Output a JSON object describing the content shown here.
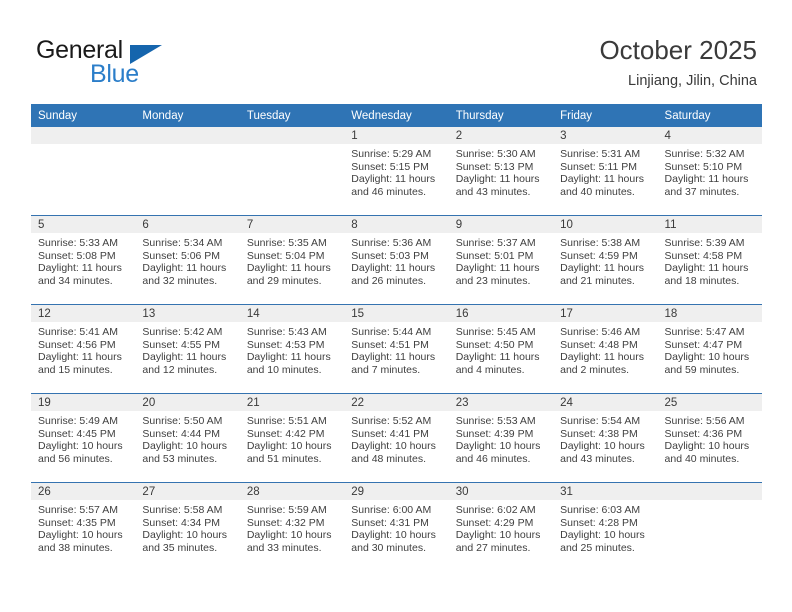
{
  "brand": {
    "word_one": "General",
    "word_two": "Blue",
    "triangle_color": "#1565ad",
    "blue_color": "#2b7ec9"
  },
  "header": {
    "month_title": "October 2025",
    "location": "Linjiang, Jilin, China",
    "header_bg": "#2f74b5",
    "band_bg": "#efefef"
  },
  "weekday_headers": [
    "Sunday",
    "Monday",
    "Tuesday",
    "Wednesday",
    "Thursday",
    "Friday",
    "Saturday"
  ],
  "labels": {
    "sunrise_prefix": "Sunrise:",
    "sunset_prefix": "Sunset:",
    "daylight_prefix": "Daylight:"
  },
  "weeks": [
    [
      {
        "day": "",
        "empty": true
      },
      {
        "day": "",
        "empty": true
      },
      {
        "day": "",
        "empty": true
      },
      {
        "day": "1",
        "sunrise": "Sunrise: 5:29 AM",
        "sunset": "Sunset: 5:15 PM",
        "daylight_l1": "Daylight: 11 hours",
        "daylight_l2": "and 46 minutes."
      },
      {
        "day": "2",
        "sunrise": "Sunrise: 5:30 AM",
        "sunset": "Sunset: 5:13 PM",
        "daylight_l1": "Daylight: 11 hours",
        "daylight_l2": "and 43 minutes."
      },
      {
        "day": "3",
        "sunrise": "Sunrise: 5:31 AM",
        "sunset": "Sunset: 5:11 PM",
        "daylight_l1": "Daylight: 11 hours",
        "daylight_l2": "and 40 minutes."
      },
      {
        "day": "4",
        "sunrise": "Sunrise: 5:32 AM",
        "sunset": "Sunset: 5:10 PM",
        "daylight_l1": "Daylight: 11 hours",
        "daylight_l2": "and 37 minutes."
      }
    ],
    [
      {
        "day": "5",
        "sunrise": "Sunrise: 5:33 AM",
        "sunset": "Sunset: 5:08 PM",
        "daylight_l1": "Daylight: 11 hours",
        "daylight_l2": "and 34 minutes."
      },
      {
        "day": "6",
        "sunrise": "Sunrise: 5:34 AM",
        "sunset": "Sunset: 5:06 PM",
        "daylight_l1": "Daylight: 11 hours",
        "daylight_l2": "and 32 minutes."
      },
      {
        "day": "7",
        "sunrise": "Sunrise: 5:35 AM",
        "sunset": "Sunset: 5:04 PM",
        "daylight_l1": "Daylight: 11 hours",
        "daylight_l2": "and 29 minutes."
      },
      {
        "day": "8",
        "sunrise": "Sunrise: 5:36 AM",
        "sunset": "Sunset: 5:03 PM",
        "daylight_l1": "Daylight: 11 hours",
        "daylight_l2": "and 26 minutes."
      },
      {
        "day": "9",
        "sunrise": "Sunrise: 5:37 AM",
        "sunset": "Sunset: 5:01 PM",
        "daylight_l1": "Daylight: 11 hours",
        "daylight_l2": "and 23 minutes."
      },
      {
        "day": "10",
        "sunrise": "Sunrise: 5:38 AM",
        "sunset": "Sunset: 4:59 PM",
        "daylight_l1": "Daylight: 11 hours",
        "daylight_l2": "and 21 minutes."
      },
      {
        "day": "11",
        "sunrise": "Sunrise: 5:39 AM",
        "sunset": "Sunset: 4:58 PM",
        "daylight_l1": "Daylight: 11 hours",
        "daylight_l2": "and 18 minutes."
      }
    ],
    [
      {
        "day": "12",
        "sunrise": "Sunrise: 5:41 AM",
        "sunset": "Sunset: 4:56 PM",
        "daylight_l1": "Daylight: 11 hours",
        "daylight_l2": "and 15 minutes."
      },
      {
        "day": "13",
        "sunrise": "Sunrise: 5:42 AM",
        "sunset": "Sunset: 4:55 PM",
        "daylight_l1": "Daylight: 11 hours",
        "daylight_l2": "and 12 minutes."
      },
      {
        "day": "14",
        "sunrise": "Sunrise: 5:43 AM",
        "sunset": "Sunset: 4:53 PM",
        "daylight_l1": "Daylight: 11 hours",
        "daylight_l2": "and 10 minutes."
      },
      {
        "day": "15",
        "sunrise": "Sunrise: 5:44 AM",
        "sunset": "Sunset: 4:51 PM",
        "daylight_l1": "Daylight: 11 hours",
        "daylight_l2": "and 7 minutes."
      },
      {
        "day": "16",
        "sunrise": "Sunrise: 5:45 AM",
        "sunset": "Sunset: 4:50 PM",
        "daylight_l1": "Daylight: 11 hours",
        "daylight_l2": "and 4 minutes."
      },
      {
        "day": "17",
        "sunrise": "Sunrise: 5:46 AM",
        "sunset": "Sunset: 4:48 PM",
        "daylight_l1": "Daylight: 11 hours",
        "daylight_l2": "and 2 minutes."
      },
      {
        "day": "18",
        "sunrise": "Sunrise: 5:47 AM",
        "sunset": "Sunset: 4:47 PM",
        "daylight_l1": "Daylight: 10 hours",
        "daylight_l2": "and 59 minutes."
      }
    ],
    [
      {
        "day": "19",
        "sunrise": "Sunrise: 5:49 AM",
        "sunset": "Sunset: 4:45 PM",
        "daylight_l1": "Daylight: 10 hours",
        "daylight_l2": "and 56 minutes."
      },
      {
        "day": "20",
        "sunrise": "Sunrise: 5:50 AM",
        "sunset": "Sunset: 4:44 PM",
        "daylight_l1": "Daylight: 10 hours",
        "daylight_l2": "and 53 minutes."
      },
      {
        "day": "21",
        "sunrise": "Sunrise: 5:51 AM",
        "sunset": "Sunset: 4:42 PM",
        "daylight_l1": "Daylight: 10 hours",
        "daylight_l2": "and 51 minutes."
      },
      {
        "day": "22",
        "sunrise": "Sunrise: 5:52 AM",
        "sunset": "Sunset: 4:41 PM",
        "daylight_l1": "Daylight: 10 hours",
        "daylight_l2": "and 48 minutes."
      },
      {
        "day": "23",
        "sunrise": "Sunrise: 5:53 AM",
        "sunset": "Sunset: 4:39 PM",
        "daylight_l1": "Daylight: 10 hours",
        "daylight_l2": "and 46 minutes."
      },
      {
        "day": "24",
        "sunrise": "Sunrise: 5:54 AM",
        "sunset": "Sunset: 4:38 PM",
        "daylight_l1": "Daylight: 10 hours",
        "daylight_l2": "and 43 minutes."
      },
      {
        "day": "25",
        "sunrise": "Sunrise: 5:56 AM",
        "sunset": "Sunset: 4:36 PM",
        "daylight_l1": "Daylight: 10 hours",
        "daylight_l2": "and 40 minutes."
      }
    ],
    [
      {
        "day": "26",
        "sunrise": "Sunrise: 5:57 AM",
        "sunset": "Sunset: 4:35 PM",
        "daylight_l1": "Daylight: 10 hours",
        "daylight_l2": "and 38 minutes."
      },
      {
        "day": "27",
        "sunrise": "Sunrise: 5:58 AM",
        "sunset": "Sunset: 4:34 PM",
        "daylight_l1": "Daylight: 10 hours",
        "daylight_l2": "and 35 minutes."
      },
      {
        "day": "28",
        "sunrise": "Sunrise: 5:59 AM",
        "sunset": "Sunset: 4:32 PM",
        "daylight_l1": "Daylight: 10 hours",
        "daylight_l2": "and 33 minutes."
      },
      {
        "day": "29",
        "sunrise": "Sunrise: 6:00 AM",
        "sunset": "Sunset: 4:31 PM",
        "daylight_l1": "Daylight: 10 hours",
        "daylight_l2": "and 30 minutes."
      },
      {
        "day": "30",
        "sunrise": "Sunrise: 6:02 AM",
        "sunset": "Sunset: 4:29 PM",
        "daylight_l1": "Daylight: 10 hours",
        "daylight_l2": "and 27 minutes."
      },
      {
        "day": "31",
        "sunrise": "Sunrise: 6:03 AM",
        "sunset": "Sunset: 4:28 PM",
        "daylight_l1": "Daylight: 10 hours",
        "daylight_l2": "and 25 minutes."
      },
      {
        "day": "",
        "empty": true
      }
    ]
  ]
}
